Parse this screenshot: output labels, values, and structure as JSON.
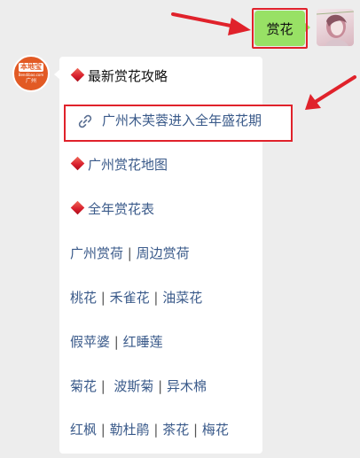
{
  "outgoing_message": "赏花",
  "bot_avatar": {
    "logo_main": "本地宝",
    "logo_sub": "Bendibao.com",
    "logo_city": "广州"
  },
  "reply": {
    "heading_1": "最新赏花攻略",
    "link_article": "广州木芙蓉进入全年盛花期",
    "heading_2": "广州赏花地图",
    "heading_3": "全年赏花表",
    "rows": [
      [
        "广州赏荷",
        "周边赏荷"
      ],
      [
        "桃花",
        "禾雀花",
        "油菜花"
      ],
      [
        "假苹婆",
        "红睡莲"
      ],
      [
        "菊花",
        " 波斯菊",
        "异木棉"
      ],
      [
        "红枫",
        "勒杜鹃",
        "茶花",
        "梅花"
      ]
    ]
  },
  "icons": {
    "link_icon": "link-icon",
    "diamond_bullet": "red-diamond-icon",
    "annotation_arrow": "red-arrow-icon"
  },
  "colors": {
    "outgoing_bubble": "#98e165",
    "annotation_red": "#e0222b",
    "link_text": "#3a5a8a",
    "background": "#ededed"
  }
}
